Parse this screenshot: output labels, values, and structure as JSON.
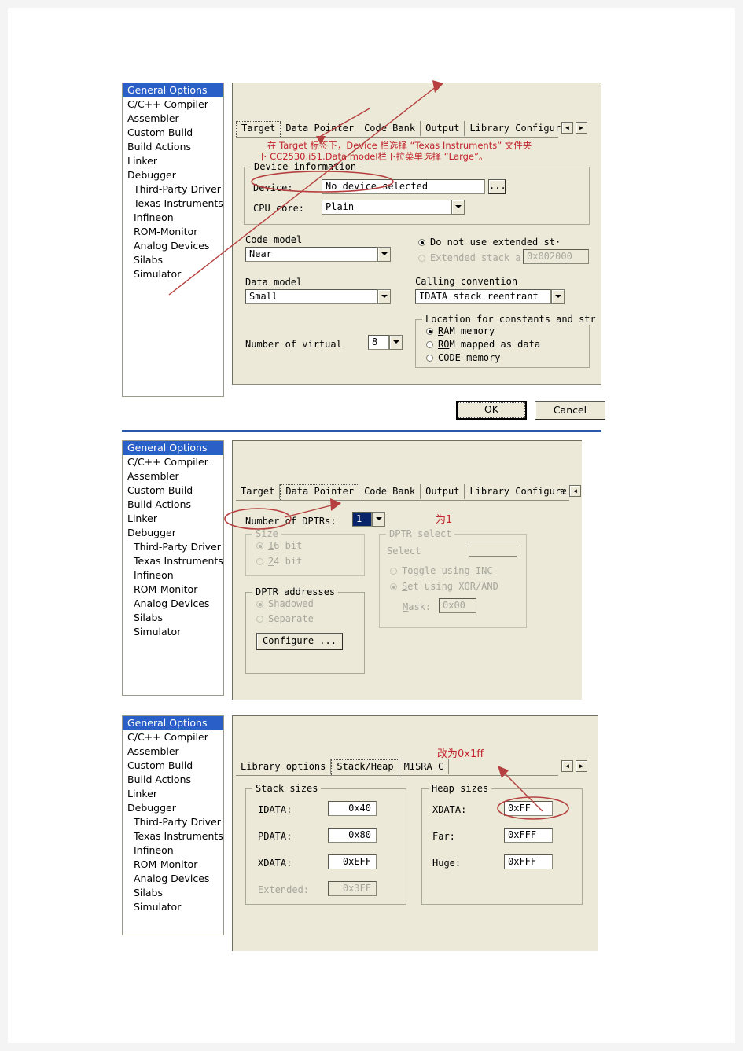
{
  "document": {
    "background": "#f4f4f4",
    "page_background": "#ffffff",
    "separator_color": "#2b57a8",
    "annotation_color": "#c1272d",
    "dialog_background": "#ece9d8",
    "selection_color": "#2a5fc8"
  },
  "sidebar": {
    "items": [
      {
        "label": "General Options",
        "selected": true,
        "indent": false
      },
      {
        "label": "C/C++ Compiler",
        "selected": false,
        "indent": false
      },
      {
        "label": "Assembler",
        "selected": false,
        "indent": false
      },
      {
        "label": "Custom Build",
        "selected": false,
        "indent": false
      },
      {
        "label": "Build Actions",
        "selected": false,
        "indent": false
      },
      {
        "label": "Linker",
        "selected": false,
        "indent": false
      },
      {
        "label": "Debugger",
        "selected": false,
        "indent": false
      },
      {
        "label": "Third-Party Driver",
        "selected": false,
        "indent": true
      },
      {
        "label": "Texas Instruments",
        "selected": false,
        "indent": true
      },
      {
        "label": "Infineon",
        "selected": false,
        "indent": true
      },
      {
        "label": "ROM-Monitor",
        "selected": false,
        "indent": true
      },
      {
        "label": "Analog Devices",
        "selected": false,
        "indent": true
      },
      {
        "label": "Silabs",
        "selected": false,
        "indent": true
      },
      {
        "label": "Simulator",
        "selected": false,
        "indent": true
      }
    ]
  },
  "dialog1": {
    "tabs": [
      {
        "label": "Target",
        "active": true
      },
      {
        "label": "Data Pointer",
        "active": false
      },
      {
        "label": "Code Bank",
        "active": false
      },
      {
        "label": "Output",
        "active": false
      },
      {
        "label": "Library Configuræ",
        "active": false
      }
    ],
    "scroll_left": "◄",
    "scroll_right": "►",
    "annotation_line1": "在 Target 标签下，Device 栏选择 “Texas Instruments” 文件夹",
    "annotation_line2": "下 CC2530.i51.Data model栏下拉菜单选择 “Large”。",
    "device_information": {
      "title": "Device information",
      "device_label": "Device:",
      "device_value": "No device selected",
      "browse_button": "...",
      "cpu_core_label": "CPU core:",
      "cpu_core_value": "Plain"
    },
    "code_model": {
      "label": "Code model",
      "value": "Near"
    },
    "data_model": {
      "label": "Data model",
      "value": "Small"
    },
    "number_of_virtual": {
      "label": "Number of virtual",
      "value": "8"
    },
    "stack_options": {
      "do_not_use_label": "Do not use extended st·",
      "do_not_use_selected": true,
      "extended_label": "Extended stack a",
      "extended_selected": false,
      "extended_value": "0x002000"
    },
    "calling_convention": {
      "label": "Calling convention",
      "value": "IDATA stack reentrant"
    },
    "location_constants": {
      "title": "Location for constants and str",
      "options": [
        {
          "label": "RAM memory",
          "underline": "RAM",
          "selected": true
        },
        {
          "label": "ROM mapped as data",
          "underline": "ROM",
          "selected": false
        },
        {
          "label": "CODE memory",
          "underline": "CODE",
          "selected": false
        }
      ]
    },
    "ok_button": "OK",
    "cancel_button": "Cancel"
  },
  "dialog2": {
    "tabs": [
      {
        "label": "Target",
        "active": false
      },
      {
        "label": "Data Pointer",
        "active": true
      },
      {
        "label": "Code Bank",
        "active": false
      },
      {
        "label": "Output",
        "active": false
      },
      {
        "label": "Library Configuræ",
        "active": false
      }
    ],
    "scroll_left": "◄",
    "number_of_dptrs_label": "Number of DPTRs:",
    "number_of_dptrs_value": "1",
    "annotation": "为1",
    "size_group": {
      "title": "Size",
      "options": [
        {
          "label": "16 bit",
          "underline": "1",
          "selected": true
        },
        {
          "label": "24 bit",
          "underline": "2",
          "selected": false
        }
      ]
    },
    "dptr_addresses_group": {
      "title": "DPTR addresses",
      "options": [
        {
          "label": "Shadowed",
          "selected": true
        },
        {
          "label": "Separate",
          "selected": false
        }
      ],
      "configure_button": "Configure ..."
    },
    "dptr_select_group": {
      "title": "DPTR select",
      "select_label": "Select",
      "select_value": "",
      "toggle_label": "Toggle using INC",
      "toggle_selected": false,
      "set_label": "Set using XOR/AND",
      "set_selected": true,
      "mask_label": "Mask:",
      "mask_value": "0x00"
    }
  },
  "dialog3": {
    "tabs": [
      {
        "label": "Library options",
        "active": false
      },
      {
        "label": "Stack/Heap",
        "active": true
      },
      {
        "label": "MISRA C",
        "active": false
      }
    ],
    "scroll_left": "◄",
    "scroll_right": "►",
    "annotation": "改为0x1ff",
    "stack_sizes": {
      "title": "Stack sizes",
      "rows": [
        {
          "label": "IDATA:",
          "value": "0x40",
          "disabled": false
        },
        {
          "label": "PDATA:",
          "value": "0x80",
          "disabled": false
        },
        {
          "label": "XDATA:",
          "value": "0xEFF",
          "disabled": false
        },
        {
          "label": "Extended:",
          "value": "0x3FF",
          "disabled": true
        }
      ]
    },
    "heap_sizes": {
      "title": "Heap sizes",
      "rows": [
        {
          "label": "XDATA:",
          "value": "0xFF",
          "disabled": false
        },
        {
          "label": "Far:",
          "value": "0xFFF",
          "disabled": false
        },
        {
          "label": "Huge:",
          "value": "0xFFF",
          "disabled": false
        }
      ]
    }
  }
}
